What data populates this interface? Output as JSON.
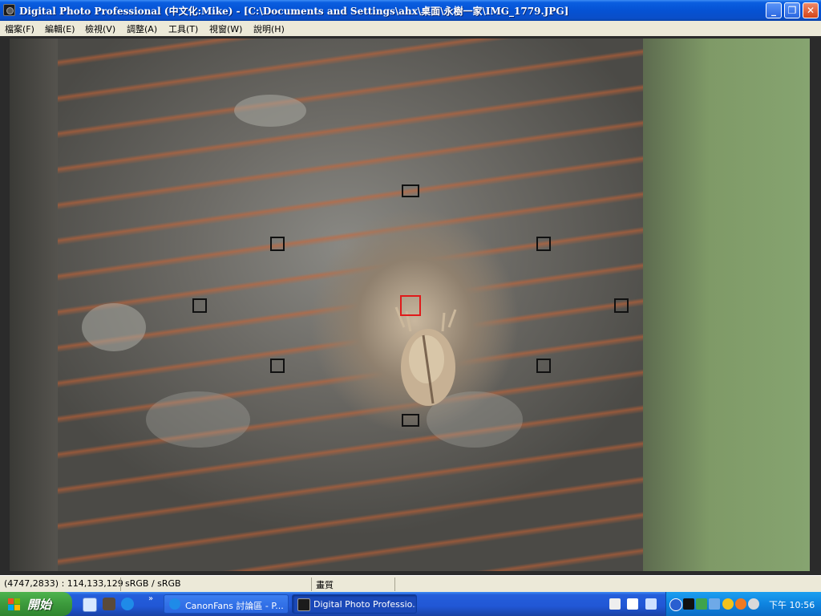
{
  "window": {
    "title": "Digital Photo Professional (中文化:Mike) - [C:\\Documents and Settings\\ahx\\桌面\\永樹一家\\IMG_1779.JPG]",
    "minimize_glyph": "_",
    "maximize_glyph": "❐",
    "close_glyph": "✕"
  },
  "menu": {
    "items": [
      {
        "label": "檔案(F)"
      },
      {
        "label": "編輯(E)"
      },
      {
        "label": "檢視(V)"
      },
      {
        "label": "調整(A)"
      },
      {
        "label": "工具(T)"
      },
      {
        "label": "視窗(W)"
      },
      {
        "label": "說明(H)"
      }
    ]
  },
  "status": {
    "pixel_info": "(4747,2833) : 114,133,129",
    "color_space": "sRGB / sRGB",
    "quality": "畫質"
  },
  "taskbar": {
    "start_label": "開始",
    "quick_launch_more": "»",
    "tasks": [
      {
        "label": "CanonFans 討論區 - P...",
        "icon": "ie-icon"
      },
      {
        "label": "Digital Photo Professio...",
        "icon": "camera-icon"
      }
    ],
    "clock": "下午 10:56"
  },
  "colors": {
    "af_point_active": "#e01a1a",
    "af_point": "#111111",
    "titlebar": "#0552d4",
    "start_button": "#3c9a3c"
  }
}
